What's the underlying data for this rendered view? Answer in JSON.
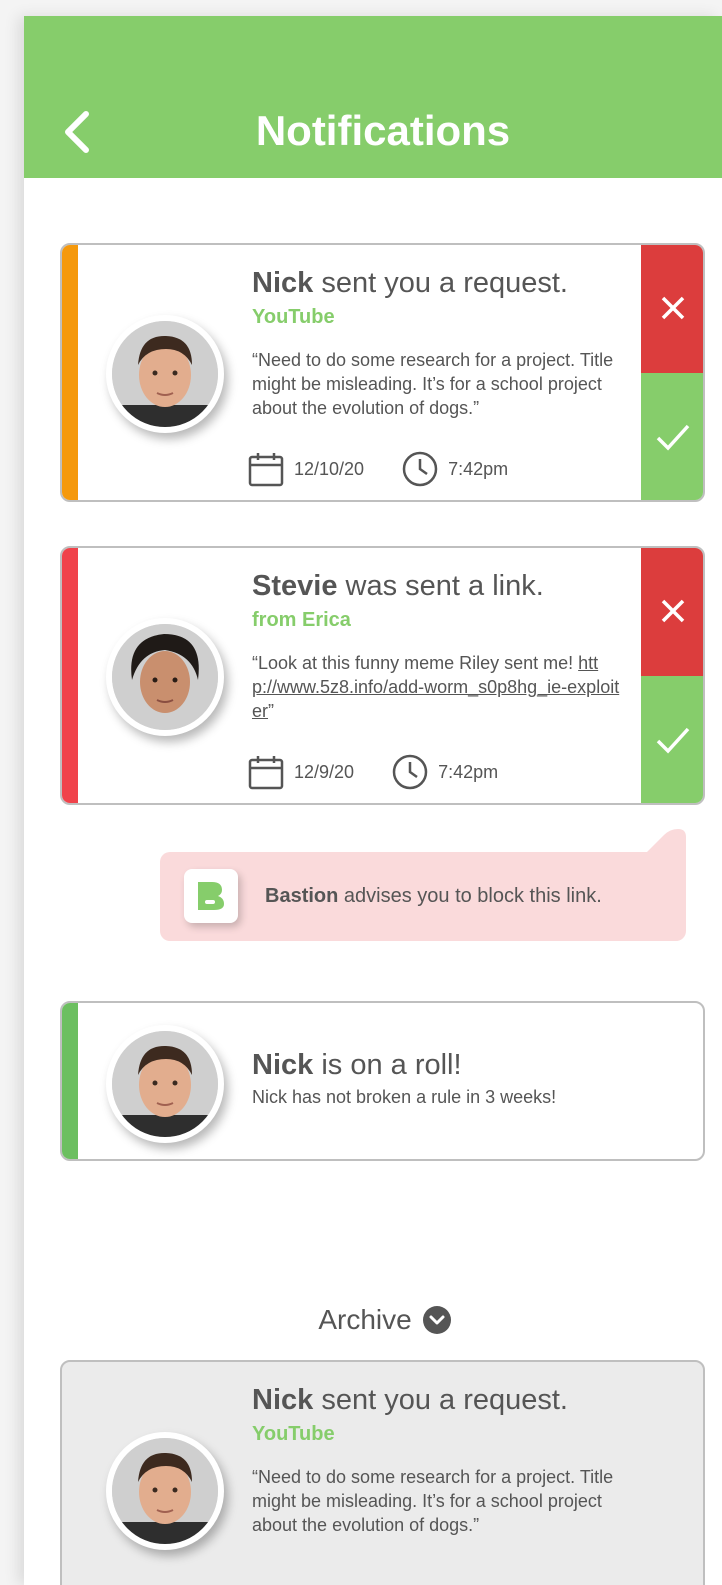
{
  "header": {
    "title": "Notifications",
    "background": "#86cd6b"
  },
  "icons": {
    "back": "chevron-left-icon",
    "calendar": "calendar-icon",
    "clock": "clock-icon",
    "reject": "x-icon",
    "accept": "check-icon",
    "archive_toggle": "chevron-down-circle-icon"
  },
  "colors": {
    "accent_green": "#86cd6b",
    "reject_red": "#dc3d3d",
    "stripe_orange": "#f5990d",
    "stripe_red": "#f0434b",
    "stripe_green": "#6cbf60",
    "advice_bg": "#fadadb"
  },
  "notifications": [
    {
      "name": "Nick",
      "action": " sent you a request.",
      "source": "YouTube",
      "message": "“Need to do some research for a project. Title might be misleading. It’s for a school project about the evolution of dogs.”",
      "date": "12/10/20",
      "time": "7:42pm"
    },
    {
      "name": "Stevie",
      "action": " was sent a link.",
      "source": "from Erica",
      "message_prefix": "“Look at this funny meme Riley sent me! ",
      "message_link": "http://www.5z8.info/add-worm_s0p8hg_ie-exploiter",
      "message_suffix": "”",
      "date": "12/9/20",
      "time": "7:42pm"
    },
    {
      "name": "Nick",
      "action": " is on a roll!",
      "body": "Nick has not broken a rule in 3 weeks!"
    }
  ],
  "advice": {
    "brand": "Bastion",
    "text": " advises you to block this link."
  },
  "archive": {
    "label": "Archive",
    "items": [
      {
        "name": "Nick",
        "action": " sent you a request.",
        "source": "YouTube",
        "message": "“Need to do some research for a project. Title might be misleading. It’s for a school project about the evolution of dogs.”"
      }
    ]
  }
}
